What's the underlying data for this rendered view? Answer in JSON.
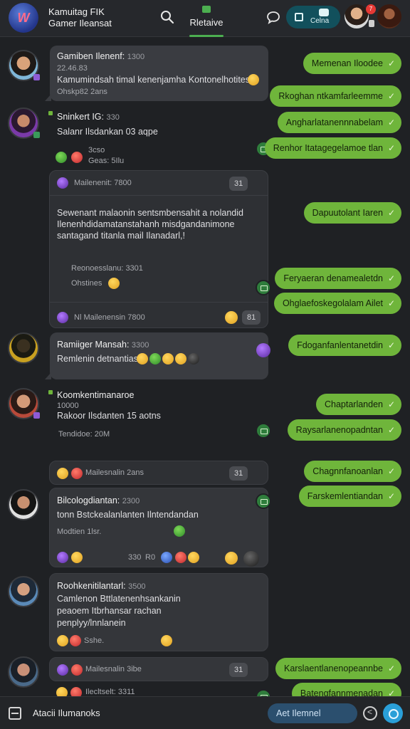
{
  "app": {
    "title": "Kamuitag FIK",
    "subtitle": "Gamer Ileansat",
    "logo_text": "W",
    "active_tab": "Rletaive",
    "pill_label": "Celna",
    "notif_badge": "7",
    "accent": "#4caf50"
  },
  "left_messages": [
    {
      "name": "Gamiben Ilenenf:",
      "time": "1300",
      "lines": [
        "22.46.83",
        "Kamumindsah timal kenenjamha Kontonelhotites"
      ],
      "meta": "Ohskp82 2ans"
    },
    {
      "name": "Sninkert IG:",
      "time": "330",
      "lines": [
        "Salanr Ilsdankan 03 aqpe"
      ],
      "meta1": "3cso",
      "meta2": "Geas: 5Ilu"
    },
    {
      "card_header": "Mailenenit:",
      "card_time": "7800",
      "card_count": "31",
      "lines": [
        "Sewenant malaonin sentsmbensahit a nolandid",
        "Ilenenhdidamatanstahanh misdgandanimone",
        "santagand titanla mail Ilanadarl,!"
      ],
      "meta1": "Reonoesslanu: 3301",
      "meta2": "Ohstines",
      "footer_name": "Nl Mailenensin",
      "footer_time": "7800",
      "footer_count": "81"
    },
    {
      "name": "Ramiiger Mansah:",
      "time": "3300",
      "lines": [
        "Remlenin detnantias"
      ]
    },
    {
      "name": "Koomkentimanaroe",
      "lines": [
        "10000",
        "Rakoor Ilsdanten 15 aotns"
      ],
      "meta": "Tendidoe: 20M"
    },
    {
      "card_header": "Mailesnalin",
      "card_time": "2ans",
      "card_count": "31"
    },
    {
      "name": "Bilcologdiantan:",
      "time": "2300",
      "lines": [
        "tonn Bstckealanlanten Ilntendandan"
      ],
      "meta": "Modtien 1lsr.",
      "reactions_time": "330",
      "reactions_label": "R0"
    },
    {
      "name": "Roohkenitilantarl:",
      "time": "3500",
      "lines": [
        "Camlenon Bttlatenenhsankanin",
        "peaoem Itbrhansar rachan",
        "penplyy/lnnlanein"
      ],
      "meta": "Sshe."
    },
    {
      "card_header": "Mailesnalin",
      "card_time": "3ibe",
      "card_count": "31"
    },
    {
      "card_header": "Ilecltselt:",
      "card_time": "3311",
      "card_count": ""
    }
  ],
  "right_messages": [
    "Memenan Iloodee",
    "Rkoghan ntkamfarleemme",
    "Angharlatanennnabelam",
    "Renhor Itatagegelamoe tlan",
    "Dapuutolant Iaren",
    "Feryaeran denamealetdn",
    "Ohglaefoskegolalam Ailet",
    "Fdoganfanlentanetdin",
    "Chaptarlanden",
    "Raysarlanenopadntan",
    "Chagnnfanoanlan",
    "Farskemlentiandan",
    "Karslaentlanenopeannbe",
    "Batengfannmenadan"
  ],
  "bottom": {
    "label": "Atacii Ilumanoks",
    "input_value": "Aet Ilemnel"
  }
}
